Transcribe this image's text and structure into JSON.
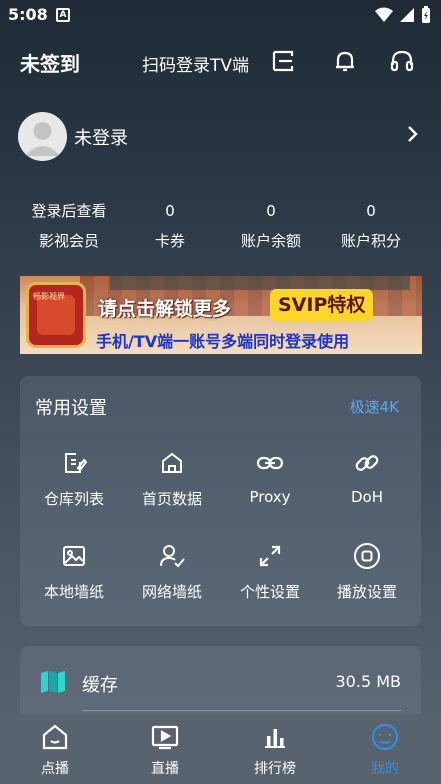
{
  "status_bar": {
    "time": "5:08",
    "notification_icon": "A"
  },
  "header": {
    "title": "未签到",
    "tv_login": "扫码登录TV端",
    "icons": [
      "scan-icon",
      "bell-icon",
      "headset-icon"
    ]
  },
  "profile": {
    "name": "未登录"
  },
  "stats": [
    {
      "value": "登录后查看",
      "label": "影视会员"
    },
    {
      "value": "0",
      "label": "卡券"
    },
    {
      "value": "0",
      "label": "账户余额"
    },
    {
      "value": "0",
      "label": "账户积分"
    }
  ],
  "banner": {
    "badge": "畅影视界",
    "line1": "请点击解锁更多",
    "svip": "SVIP特权",
    "line2": "手机/TV端一账号多端同时登录使用"
  },
  "settings": {
    "title": "常用设置",
    "link": "极速4K",
    "items": [
      {
        "label": "仓库列表",
        "icon": "edit-icon"
      },
      {
        "label": "首页数据",
        "icon": "home-icon"
      },
      {
        "label": "Proxy",
        "icon": "link-icon"
      },
      {
        "label": "DoH",
        "icon": "chain-icon"
      },
      {
        "label": "本地墙纸",
        "icon": "image-icon"
      },
      {
        "label": "网络墙纸",
        "icon": "user-check-icon"
      },
      {
        "label": "个性设置",
        "icon": "expand-icon"
      },
      {
        "label": "播放设置",
        "icon": "record-icon"
      }
    ]
  },
  "cache": {
    "label": "缓存",
    "value": "30.5 MB",
    "icon": "map-icon"
  },
  "bottom_nav": {
    "items": [
      {
        "label": "点播",
        "icon": "home-icon",
        "active": false
      },
      {
        "label": "直播",
        "icon": "play-icon",
        "active": false
      },
      {
        "label": "排行榜",
        "icon": "bar-chart-icon",
        "active": false
      },
      {
        "label": "我的",
        "icon": "profile-smile-icon",
        "active": true
      }
    ],
    "active_color": "#2f8de4"
  },
  "colors": {
    "accent": "#5aa7f0",
    "background_top": "#1f2a36",
    "background_bottom": "#5a6571"
  }
}
